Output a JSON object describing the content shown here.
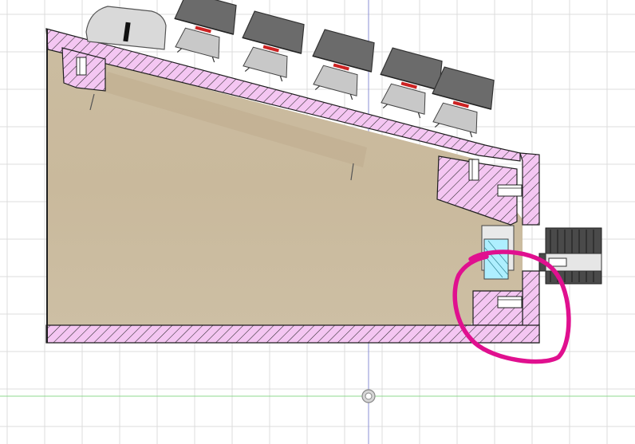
{
  "viewport": {
    "background": "#ffffff",
    "grid_color": "#dcdcdc",
    "vertical_axis_color": "#8b8fd6",
    "horizontal_axis_color": "#8fd98f",
    "origin_marker": "origin-icon"
  },
  "section_view": {
    "section_fill": "#f4c6f2",
    "hatch_color": "#2a2a2a",
    "outline_color": "#1e1e1e",
    "interior_color": "#cbbca0"
  },
  "keycaps": {
    "count": 5,
    "cap_color": "#6b6b6b",
    "switch_color": "#c8c8c8",
    "stem_color": "#cc2222"
  },
  "rotary_knob": {
    "color": "#d9d9d9",
    "marker_color": "#111111"
  },
  "connector": {
    "color": "#4a4a4a",
    "cable_color": "#aeefff"
  },
  "annotation": {
    "color": "#e0108f",
    "meaning": "circled-area"
  }
}
